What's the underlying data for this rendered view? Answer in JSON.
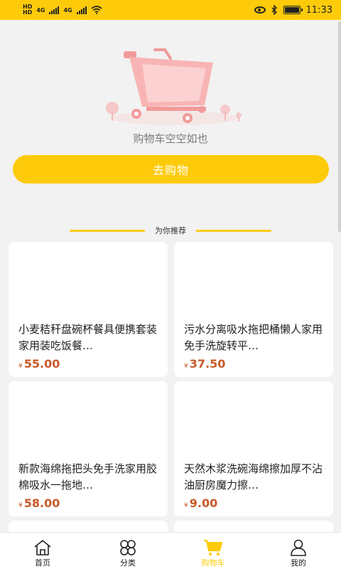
{
  "status_bar": {
    "hd_top": "HD",
    "hd_bottom": "HD",
    "net1": "4G",
    "net2": "4G",
    "time": "11:33"
  },
  "empty_cart": {
    "message": "购物车空空如也",
    "button_label": "去购物"
  },
  "recommend": {
    "title": "为你推荐",
    "products": [
      {
        "name": "小麦秸秆盘碗杯餐具便携套装家用装吃饭餐…",
        "currency": "¥",
        "price": "55.00"
      },
      {
        "name": "污水分离吸水拖把桶懒人家用免手洗旋转平…",
        "currency": "¥",
        "price": "37.50"
      },
      {
        "name": "新款海绵拖把头免手洗家用胶棉吸水一拖地…",
        "currency": "¥",
        "price": "58.00"
      },
      {
        "name": "天然木浆洗碗海绵擦加厚不沾油厨房魔力擦…",
        "currency": "¥",
        "price": "9.00"
      }
    ]
  },
  "tabbar": {
    "items": [
      {
        "label": "首页",
        "icon": "home-icon"
      },
      {
        "label": "分类",
        "icon": "category-icon"
      },
      {
        "label": "购物车",
        "icon": "cart-icon"
      },
      {
        "label": "我的",
        "icon": "profile-icon"
      }
    ],
    "active_index": 2
  },
  "colors": {
    "accent": "#fdcb0a",
    "price": "#c8592a",
    "background": "#f2f2f2"
  }
}
